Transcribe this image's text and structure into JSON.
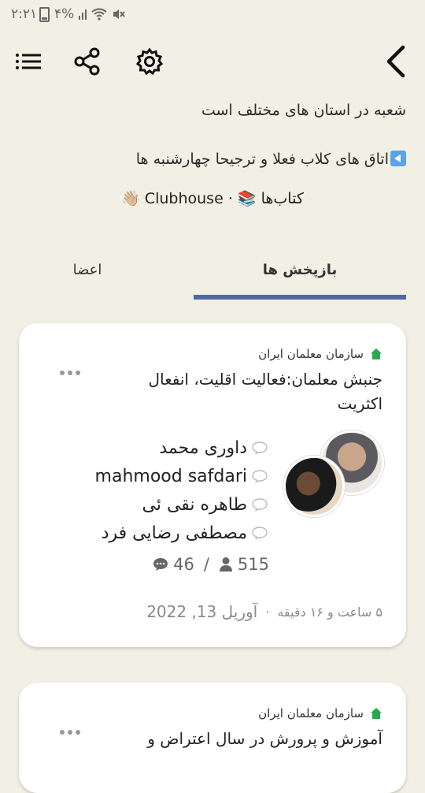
{
  "status_bar": {
    "time": "۲:۲۱",
    "battery": "۴%"
  },
  "toolbar": {
    "icons": [
      "list-icon",
      "share-icon",
      "settings-icon",
      "back-arrow-icon"
    ]
  },
  "about": {
    "line1": "شعبه در استان های مختلف است",
    "rooms_line": "اتاق های کلاب فعلا و ترجیحا چهارشنبه ها",
    "tags": "کتاب‌ها 📚 · Clubhouse 👋🏼"
  },
  "tabs": {
    "replays": "بازپخش ها",
    "members": "اعضا"
  },
  "card1": {
    "org": "سازمان معلمان ایران",
    "title": "جنبش معلمان:فعالیت اقلیت، انفعال اکثریت",
    "speakers": [
      "داوری محمد",
      "mahmood safdari",
      "طاهره نقی ئی",
      "مصطفی رضایی فرد"
    ],
    "listeners": "515",
    "chats": "46",
    "separator": "/",
    "duration": "۵ ساعت و ۱۶ دقیقه",
    "dot": "·",
    "date": "آوریل 13, 2022"
  },
  "card2": {
    "org": "سازمان معلمان ایران",
    "title": "آموزش و پرورش در سال اعتراض و"
  },
  "colors": {
    "background": "#f2f0e4",
    "tab_underline": "#4d6aa6",
    "home_icon": "#2ba84a"
  }
}
